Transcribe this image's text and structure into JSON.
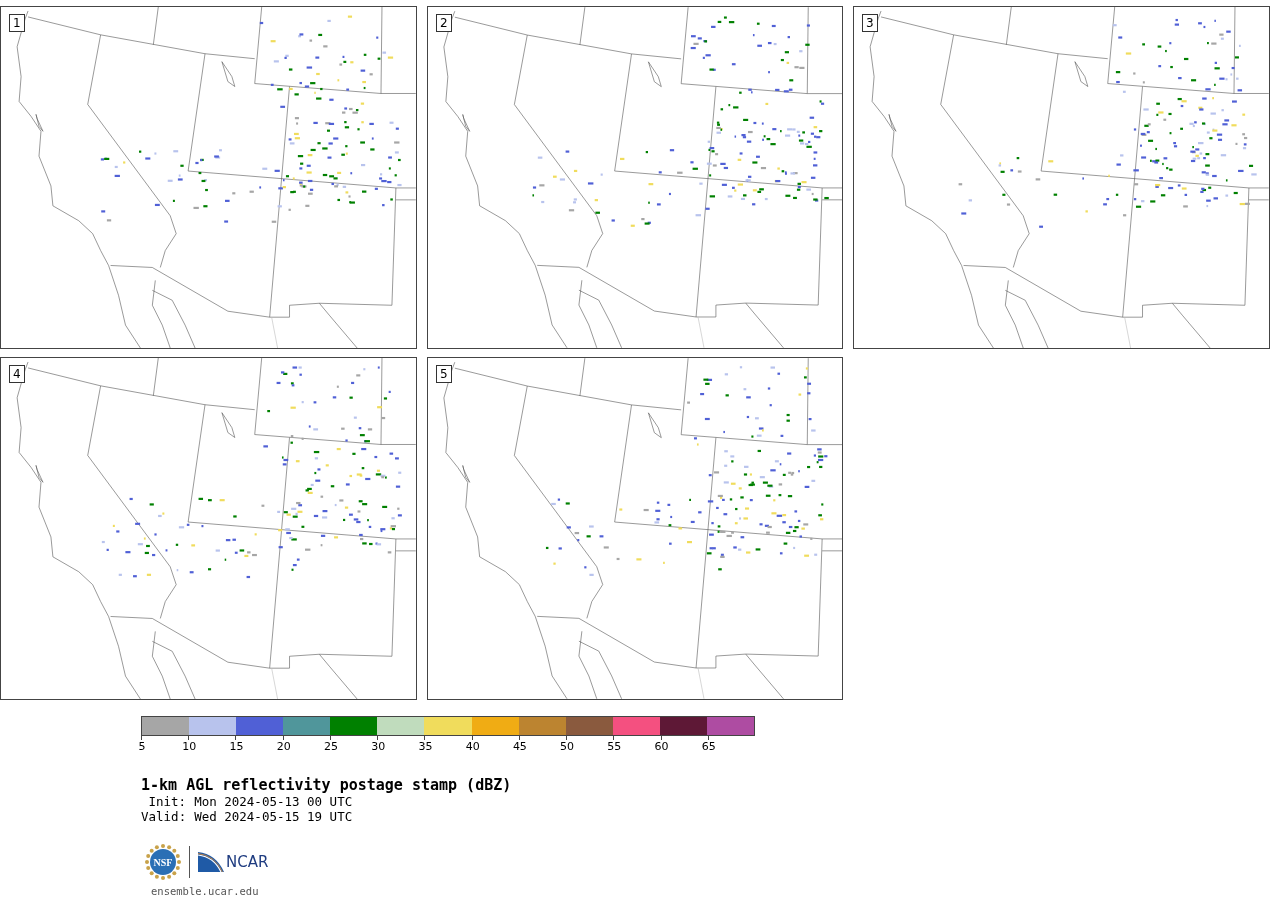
{
  "panels": [
    {
      "label": "1"
    },
    {
      "label": "2"
    },
    {
      "label": "3"
    },
    {
      "label": "4"
    },
    {
      "label": "5"
    }
  ],
  "colorbar": {
    "bins": [
      {
        "color": "#a6a6a6"
      },
      {
        "color": "#b8c3ed"
      },
      {
        "color": "#5060d6"
      },
      {
        "color": "#50969b"
      },
      {
        "color": "#008000"
      },
      {
        "color": "#c0dcbd"
      },
      {
        "color": "#f0dc5c"
      },
      {
        "color": "#f0ac14"
      },
      {
        "color": "#bc8430"
      },
      {
        "color": "#8a5a3e"
      },
      {
        "color": "#f45080"
      },
      {
        "color": "#5e1836"
      },
      {
        "color": "#ae4ca2"
      }
    ],
    "ticks": [
      "5",
      "10",
      "15",
      "20",
      "25",
      "30",
      "35",
      "40",
      "45",
      "50",
      "55",
      "60",
      "65"
    ]
  },
  "title": "1-km AGL reflectivity postage stamp (dBZ)",
  "times": [
    {
      "label": "Init:",
      "value": "Mon 2024-05-13 00 UTC"
    },
    {
      "label": "Valid:",
      "value": "Wed 2024-05-15 19 UTC"
    }
  ],
  "logo": {
    "seal": "NSF",
    "name": "NCAR"
  },
  "footer": "ensemble.ucar.edu"
}
